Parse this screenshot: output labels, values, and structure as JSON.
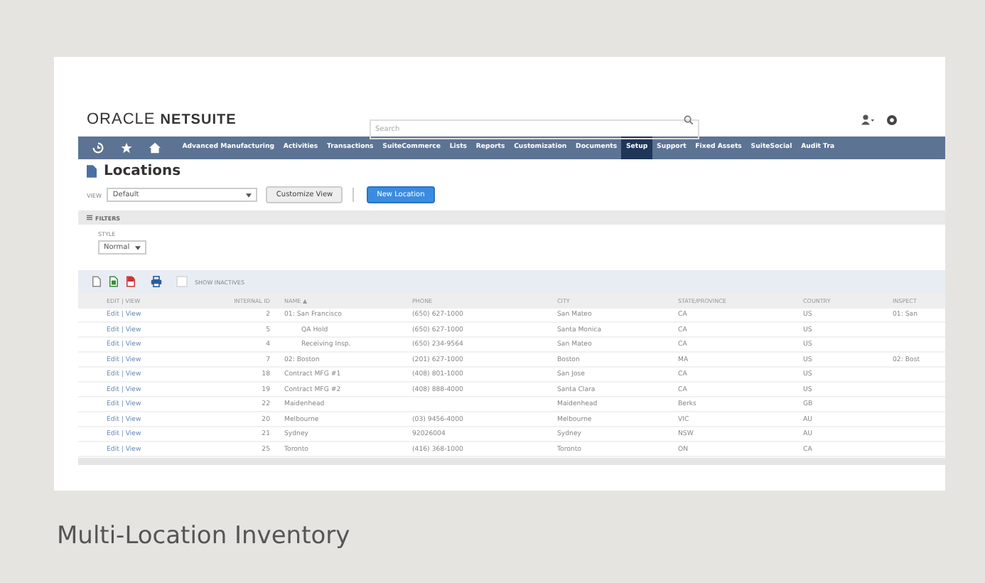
{
  "app": {
    "logo_light": "ORACLE",
    "logo_bold": "NETSUITE",
    "search": {
      "placeholder": "Search"
    }
  },
  "nav": [
    {
      "label": "Advanced Manufacturing",
      "selected": false
    },
    {
      "label": "Activities",
      "selected": false
    },
    {
      "label": "Transactions",
      "selected": false
    },
    {
      "label": "SuiteCommerce",
      "selected": false
    },
    {
      "label": "Lists",
      "selected": false
    },
    {
      "label": "Reports",
      "selected": false
    },
    {
      "label": "Customization",
      "selected": false
    },
    {
      "label": "Documents",
      "selected": false
    },
    {
      "label": "Setup",
      "selected": true
    },
    {
      "label": "Support",
      "selected": false
    },
    {
      "label": "Fixed Assets",
      "selected": false
    },
    {
      "label": "SuiteSocial",
      "selected": false
    },
    {
      "label": "Audit Tra",
      "selected": false
    }
  ],
  "page": {
    "title": "Locations",
    "view_label": "VIEW",
    "view_value": "Default",
    "customize_button": "Customize View",
    "new_button": "New Location",
    "filters_label": "FILTERS",
    "style_label": "STYLE",
    "style_value": "Normal",
    "show_inactives": {
      "label": "SHOW INACTIVES",
      "checked": false
    }
  },
  "table": {
    "columns": [
      "EDIT | VIEW",
      "INTERNAL ID",
      "NAME ▲",
      "PHONE",
      "CITY",
      "STATE/PROVINCE",
      "COUNTRY",
      "INSPECT"
    ],
    "rows": [
      {
        "action": "Edit | View",
        "id": "2",
        "name": "01: San Francisco",
        "phone": "(650) 627-1000",
        "city": "San Mateo",
        "state": "CA",
        "country": "US",
        "column_8": "01: San",
        "children": [
          {
            "action": "Edit | View",
            "id": "5",
            "name": "QA Hold",
            "phone": "(650) 627-1000",
            "city": "Santa Monica",
            "state": "CA",
            "country": "US"
          },
          {
            "action": "Edit | View",
            "id": "4",
            "name": "Receiving Insp.",
            "phone": "(650) 234-9564",
            "city": "San Mateo",
            "state": "CA",
            "country": "US"
          }
        ]
      },
      {
        "action": "Edit | View",
        "id": "7",
        "name": "02: Boston",
        "phone": "(201) 627-1000",
        "city": "Boston",
        "state": "MA",
        "country": "US",
        "column_8": "02: Bost"
      },
      {
        "action": "Edit | View",
        "id": "18",
        "name": "Contract MFG #1",
        "phone": "(408) 801-1000",
        "city": "San Jose",
        "state": "CA",
        "country": "US"
      },
      {
        "action": "Edit | View",
        "id": "19",
        "name": "Contract MFG #2",
        "phone": "(408) 888-4000",
        "city": "Santa Clara",
        "state": "CA",
        "country": "US"
      },
      {
        "action": "Edit | View",
        "id": "22",
        "name": "Maidenhead",
        "city": "Maidenhead",
        "state": "Berks",
        "country": "GB"
      },
      {
        "action": "Edit | View",
        "id": "20",
        "name": "Melbourne",
        "phone": "(03) 9456-4000",
        "city": "Melbourne",
        "state": "VIC",
        "country": "AU"
      },
      {
        "action": "Edit | View",
        "id": "21",
        "name": "Sydney",
        "phone": "92026004",
        "city": "Sydney",
        "state": "NSW",
        "country": "AU"
      },
      {
        "action": "Edit | View",
        "id": "25",
        "name": "Toronto",
        "phone": "(416) 368-1000",
        "city": "Toronto",
        "state": "ON",
        "country": "CA"
      }
    ]
  },
  "caption": "Multi-Location Inventory"
}
